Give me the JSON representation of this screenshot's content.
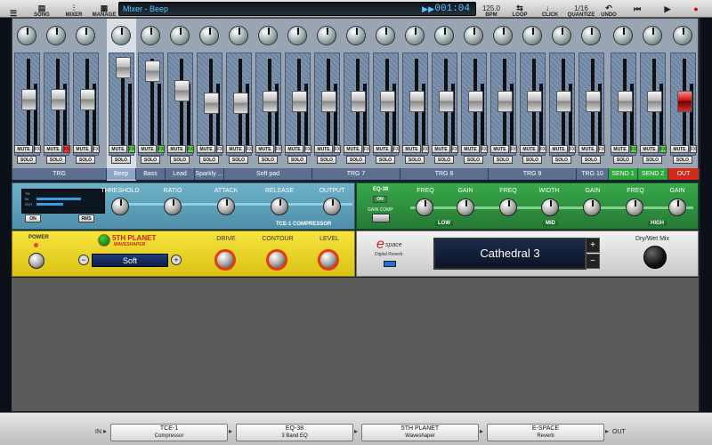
{
  "toolbar": {
    "menu_icon": "hamburger-icon",
    "buttons": [
      {
        "label": "SONG",
        "icon": "song-icon"
      },
      {
        "label": "MIXER",
        "icon": "mixer-icon"
      },
      {
        "label": "MANAGE",
        "icon": "manage-icon"
      }
    ],
    "title": "Mixer - Beep",
    "time": "001:04",
    "time_mini": "▶▶",
    "bpm_value": "125.0",
    "bpm_label": "BPM",
    "loop_label": "LOOP",
    "click_label": "CLICK",
    "quantize_value": "1/16",
    "quantize_label": "QUANTIZE",
    "undo_label": "UNDO",
    "transport": [
      "⏮",
      "▶",
      "●"
    ]
  },
  "mixer": {
    "strips": [
      {
        "mute": "MUTE",
        "solo": "SOLO",
        "fx": "FX",
        "fx_state": "off"
      },
      {
        "mute": "MUTE",
        "solo": "SOLO",
        "fx": "FX",
        "fx_state": "red"
      },
      {
        "mute": "MUTE",
        "solo": "SOLO",
        "fx": "FX",
        "fx_state": "off"
      },
      {
        "mute": "MUTE",
        "solo": "SOLO",
        "fx": "FX",
        "fx_state": "green"
      },
      {
        "mute": "MUTE",
        "solo": "SOLO",
        "fx": "FX",
        "fx_state": "green"
      },
      {
        "mute": "MUTE",
        "solo": "SOLO",
        "fx": "FX",
        "fx_state": "green"
      },
      {
        "mute": "MUTE",
        "solo": "SOLO",
        "fx": "FX",
        "fx_state": "off"
      },
      {
        "mute": "MUTE",
        "solo": "SOLO",
        "fx": "FX",
        "fx_state": "off"
      },
      {
        "mute": "MUTE",
        "solo": "SOLO",
        "fx": "FX",
        "fx_state": "off"
      },
      {
        "mute": "MUTE",
        "solo": "SOLO",
        "fx": "FX",
        "fx_state": "off"
      },
      {
        "mute": "MUTE",
        "solo": "SOLO",
        "fx": "FX",
        "fx_state": "off"
      },
      {
        "mute": "MUTE",
        "solo": "SOLO",
        "fx": "FX",
        "fx_state": "off"
      },
      {
        "mute": "MUTE",
        "solo": "SOLO",
        "fx": "FX",
        "fx_state": "off"
      },
      {
        "mute": "MUTE",
        "solo": "SOLO",
        "fx": "FX",
        "fx_state": "off"
      },
      {
        "mute": "MUTE",
        "solo": "SOLO",
        "fx": "FX",
        "fx_state": "off"
      },
      {
        "mute": "MUTE",
        "solo": "SOLO",
        "fx": "FX",
        "fx_state": "off"
      },
      {
        "mute": "MUTE",
        "solo": "SOLO",
        "fx": "FX",
        "fx_state": "off"
      },
      {
        "mute": "MUTE",
        "solo": "SOLO",
        "fx": "FX",
        "fx_state": "off"
      },
      {
        "mute": "MUTE",
        "solo": "SOLO",
        "fx": "FX",
        "fx_state": "off"
      },
      {
        "mute": "MUTE",
        "solo": "SOLO",
        "fx": "FX",
        "fx_state": "off"
      },
      {
        "mute": "MUTE",
        "solo": "SOLO",
        "fx": "FX",
        "fx_state": "green"
      },
      {
        "mute": "MUTE",
        "solo": "SOLO",
        "fx": "FX",
        "fx_state": "green"
      },
      {
        "mute": "MUTE",
        "solo": "SOLO",
        "fx": "FX",
        "fx_state": "off"
      }
    ],
    "groups": [
      {
        "label": "TRG",
        "color": "#5c6f91"
      },
      {
        "label": "Beep",
        "color": "#8fa6c8"
      },
      {
        "label": "Bass",
        "color": "#5c6f91"
      },
      {
        "label": "Lead",
        "color": "#5c6f91"
      },
      {
        "label": "Sparkly ...",
        "color": "#5c6f91"
      },
      {
        "label": "Soft pad",
        "color": "#5c6f91"
      },
      {
        "label": "TRG 7",
        "color": "#5c6f91"
      },
      {
        "label": "TRG 8",
        "color": "#5c6f91"
      },
      {
        "label": "TRG 9",
        "color": "#5c6f91"
      },
      {
        "label": "TRG 10",
        "color": "#5c6f91"
      },
      {
        "label": "SEND 1",
        "color": "#2fa83c"
      },
      {
        "label": "SEND 2",
        "color": "#2fa83c"
      },
      {
        "label": "OUT",
        "color": "#d12a1a"
      }
    ]
  },
  "compressor": {
    "meter_labels": [
      "TH",
      "IN",
      "OUT"
    ],
    "on_label": "ON",
    "rms_label": "RMS",
    "knobs": [
      "THRESHOLD",
      "RATIO",
      "ATTACK",
      "RELEASE",
      "OUTPUT"
    ],
    "name": "TCE-1 COMPRESSOR"
  },
  "eq": {
    "name": "EQ-38",
    "on_label": "ON",
    "gain_comp": "GAIN COMP",
    "knob_labels": [
      "FREQ",
      "GAIN",
      "FREQ",
      "WIDTH",
      "GAIN",
      "FREQ",
      "GAIN"
    ],
    "bands": [
      "LOW",
      "MID",
      "HIGH"
    ]
  },
  "waveshaper": {
    "power_label": "POWER",
    "brand": "5TH PLANET",
    "subtitle": "WAVESHAPER",
    "preset": "Soft",
    "knobs": [
      "DRIVE",
      "CONTOUR",
      "LEVEL"
    ]
  },
  "reverb": {
    "logo": "e",
    "logo_sub": "space",
    "caption": "Digital Reverb",
    "preset": "Cathedral 3",
    "wet_label": "Dry/Wet Mix"
  },
  "chain": {
    "in_label": "IN",
    "out_label": "OUT",
    "slots": [
      {
        "name": "TCE-1",
        "desc": "Compressor"
      },
      {
        "name": "EQ-38",
        "desc": "3 Band EQ"
      },
      {
        "name": "5TH PLANET",
        "desc": "Waveshaper"
      },
      {
        "name": "E-SPACE",
        "desc": "Reverb"
      }
    ]
  }
}
